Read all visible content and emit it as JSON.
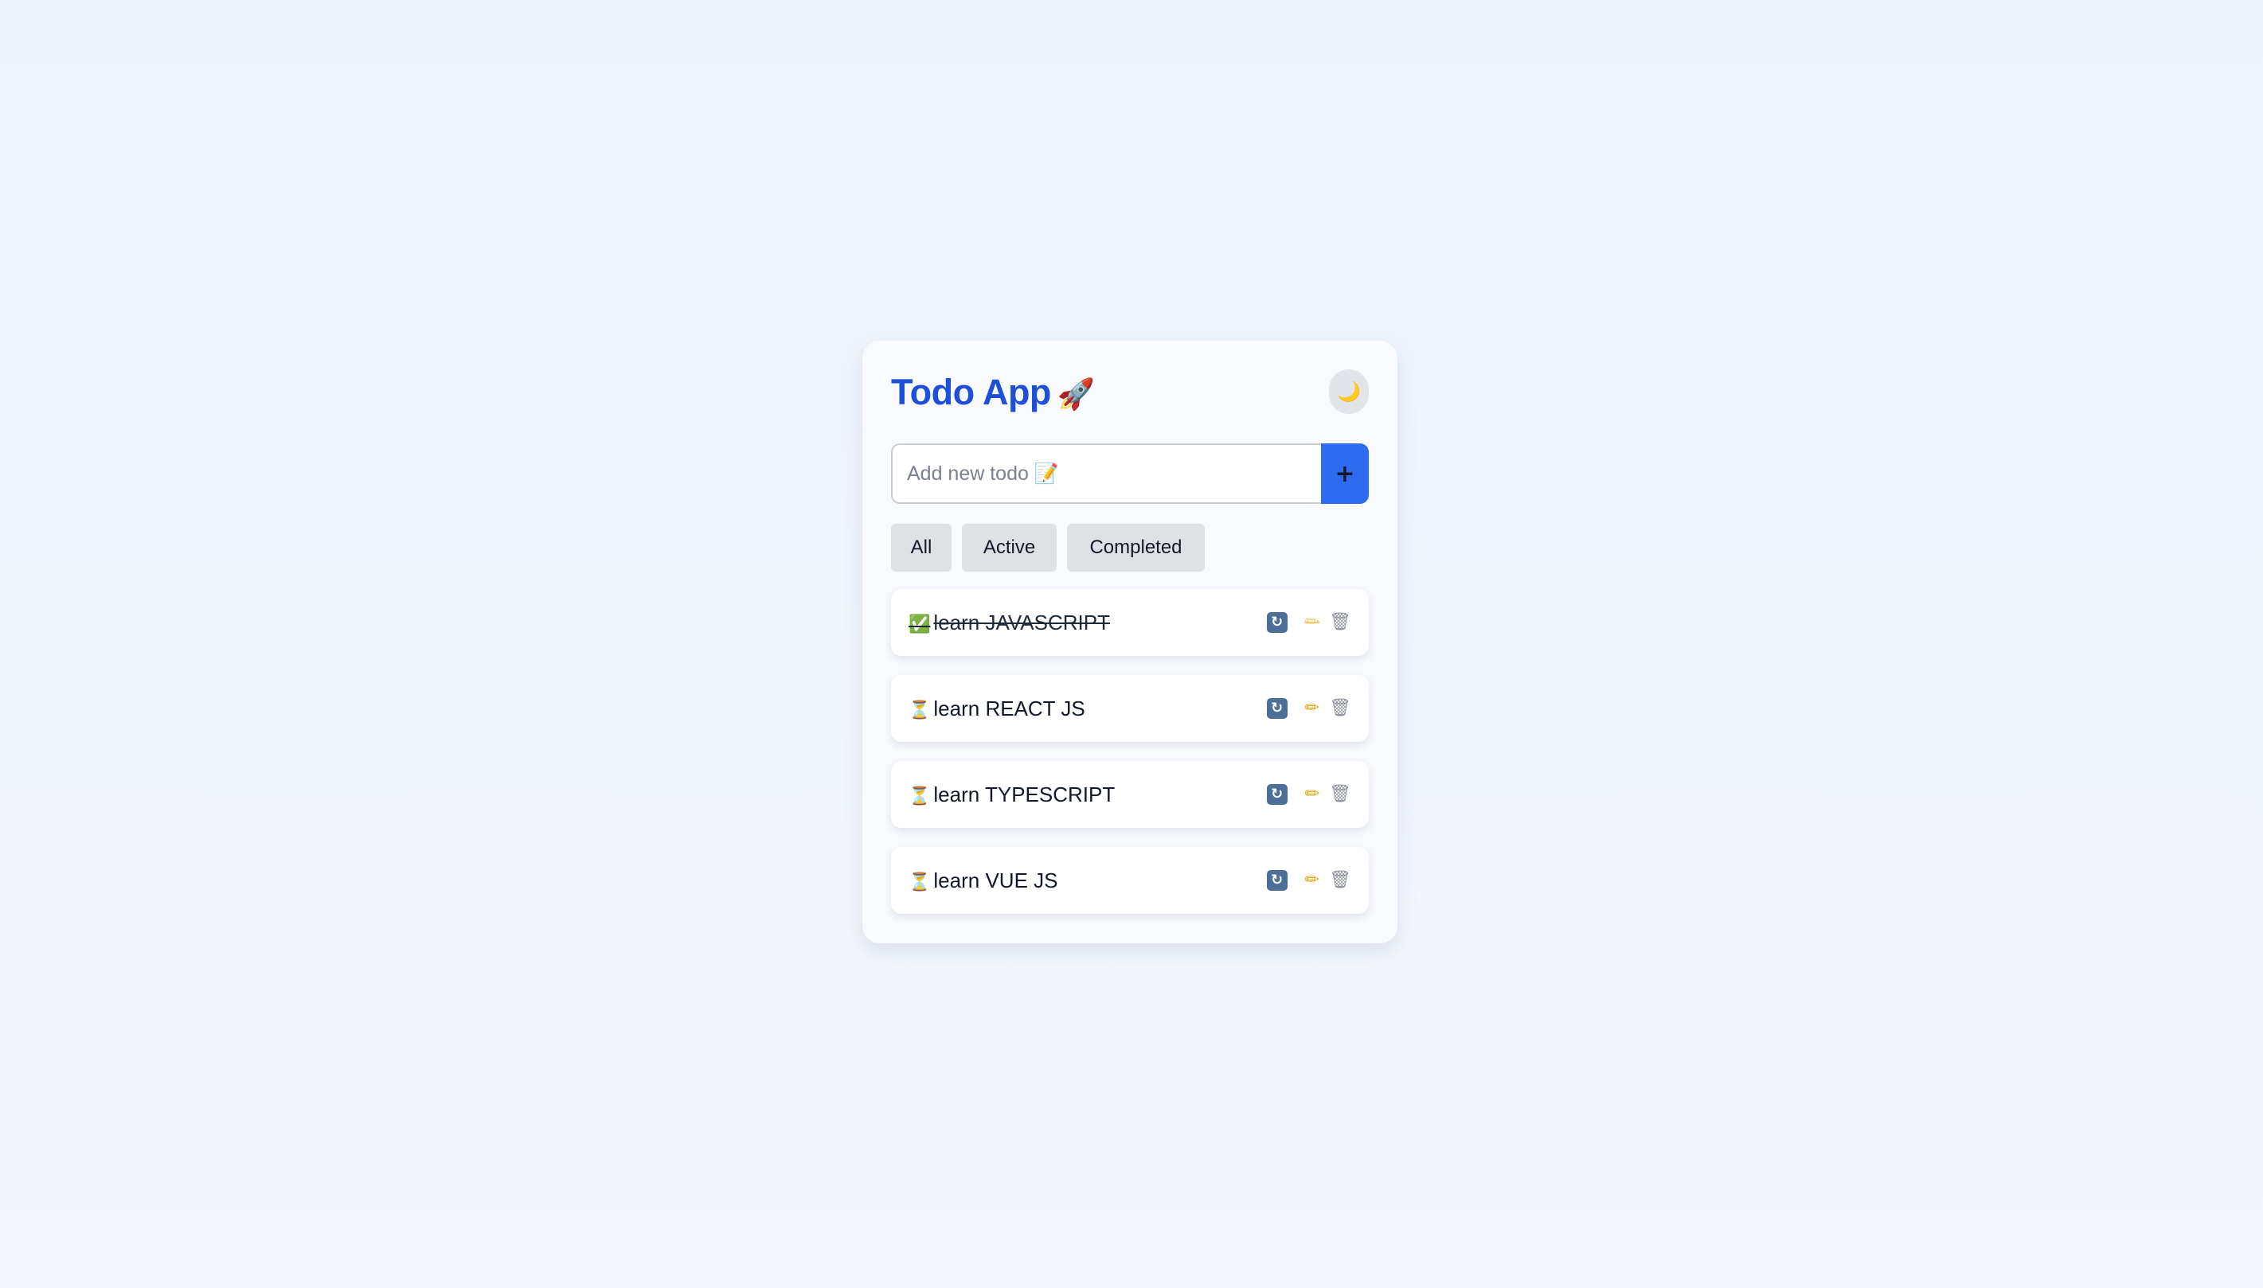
{
  "app": {
    "title": "Todo App",
    "title_emoji": "🚀",
    "theme_toggle_icon": "🌙"
  },
  "add": {
    "placeholder": "Add new todo 📝",
    "value": "",
    "button_label": "+"
  },
  "filters": [
    {
      "label": "All"
    },
    {
      "label": "Active"
    },
    {
      "label": "Completed"
    }
  ],
  "todos": [
    {
      "status_icon": "✅",
      "text": "learn JAVASCRIPT",
      "completed": true
    },
    {
      "status_icon": "⏳",
      "text": "learn REACT JS",
      "completed": false
    },
    {
      "status_icon": "⏳",
      "text": "learn TYPESCRIPT",
      "completed": false
    },
    {
      "status_icon": "⏳",
      "text": "learn VUE JS",
      "completed": false
    }
  ],
  "icons": {
    "toggle": "refresh-icon",
    "edit": "pencil-icon",
    "delete": "trash-icon",
    "theme": "moon-icon"
  },
  "colors": {
    "accent": "#2f6bf0",
    "title": "#1d4fd8",
    "background": "#eef3fb",
    "card": "#f8fafd"
  }
}
